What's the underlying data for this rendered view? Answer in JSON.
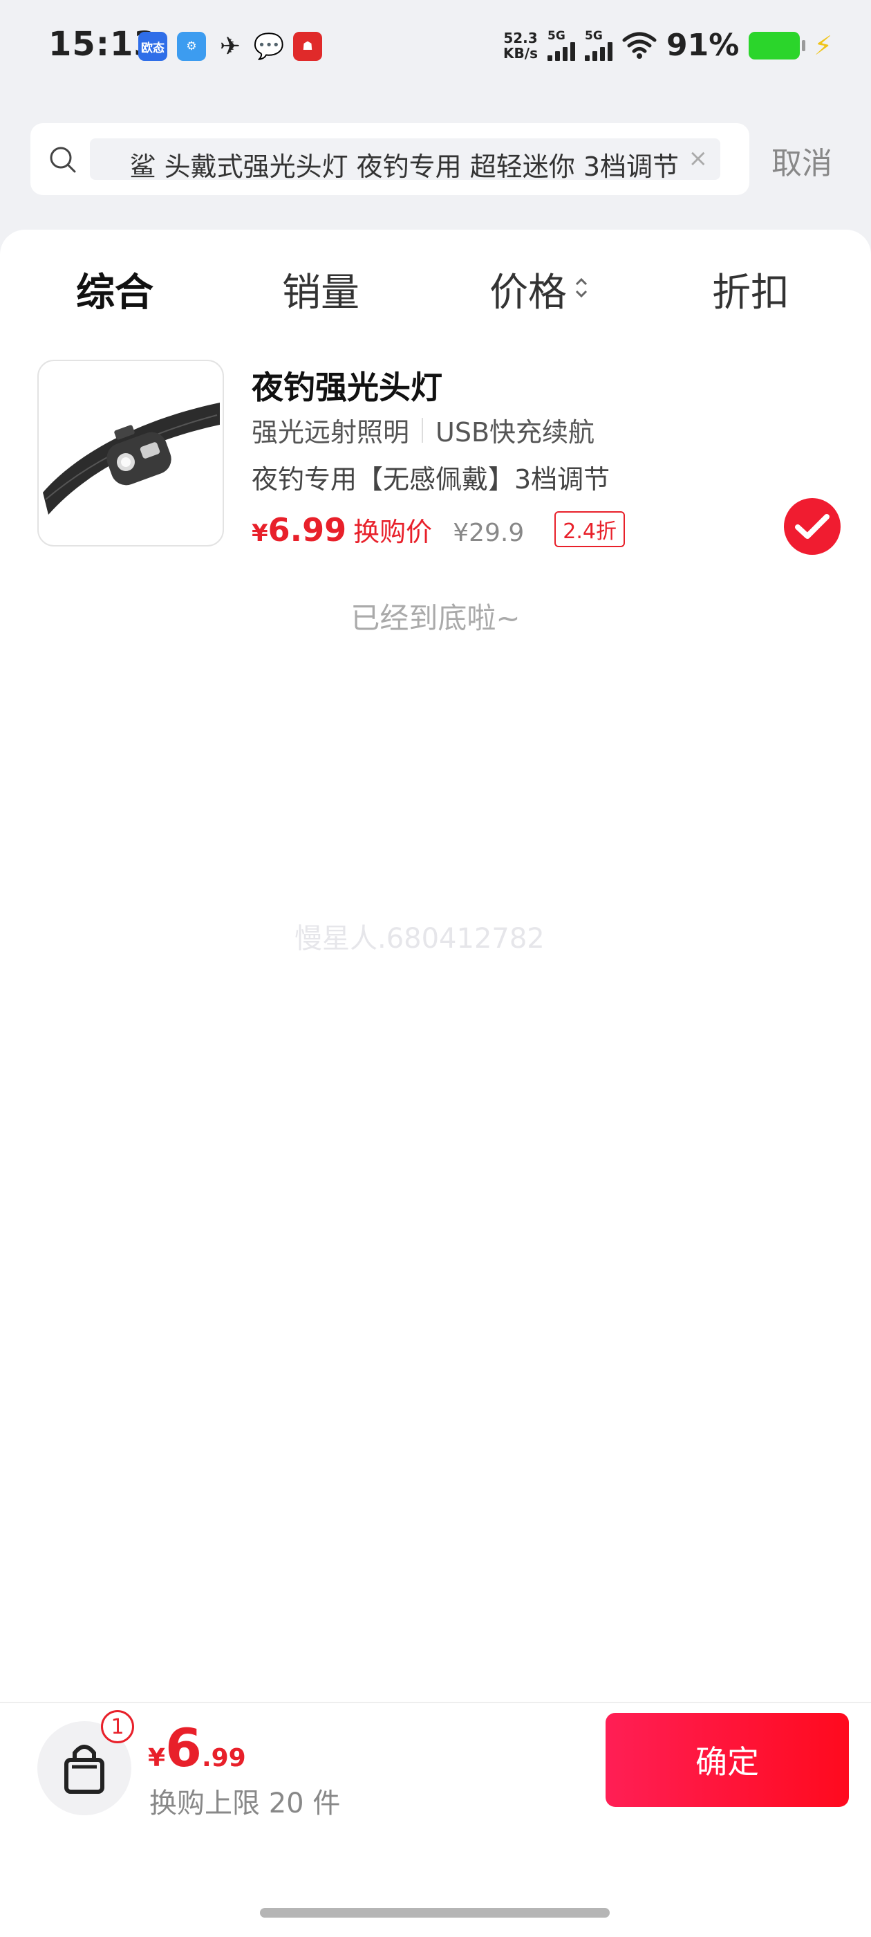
{
  "status_bar": {
    "time": "15:13",
    "app_icons": [
      "欧态",
      "settings-icon",
      "drone-icon",
      "wechat-icon",
      "shop-icon"
    ],
    "net_speed_value": "52.3",
    "net_speed_unit": "KB/s",
    "sim1": "5G",
    "sim2": "5G",
    "battery": "91%"
  },
  "search": {
    "query": "鲨 头戴式强光头灯 夜钓专用 超轻迷你 3档调节",
    "cancel_label": "取消"
  },
  "tabs": [
    {
      "label": "综合",
      "active": true
    },
    {
      "label": "销量",
      "active": false
    },
    {
      "label": "价格",
      "active": false
    },
    {
      "label": "折扣",
      "active": false
    }
  ],
  "product": {
    "title": "夜钓强光头灯",
    "tag1": "强光远射照明",
    "tag2": "USB快充续航",
    "desc": "夜钓专用【无感佩戴】3档调节",
    "currency": "¥",
    "price": "6.99",
    "price_label": "换购价",
    "original_price": "¥29.9",
    "discount": "2.4折",
    "selected": true
  },
  "end_text": "已经到底啦~",
  "watermark": "慢星人.680412782",
  "bottom": {
    "badge_count": "1",
    "total_currency": "¥",
    "total_int": "6",
    "total_dec": ".99",
    "limit_text": "换购上限 20 件",
    "confirm_label": "确定"
  },
  "colors": {
    "accent": "#e8202a",
    "confirm_gradient_start": "#ff1f55",
    "confirm_gradient_end": "#ff0a1e"
  }
}
